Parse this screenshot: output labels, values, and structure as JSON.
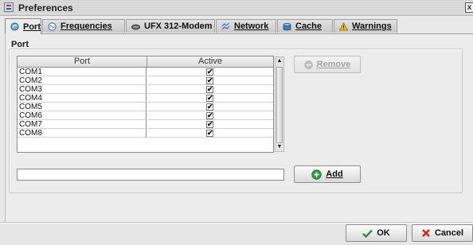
{
  "window": {
    "title": "Preferences",
    "close_glyph": "x"
  },
  "tabs": [
    {
      "label": "Port",
      "icon": "port-icon",
      "active": true
    },
    {
      "label": "Frequencies",
      "icon": "frequencies-icon",
      "active": false
    },
    {
      "label": "UFX 312-Modem",
      "icon": "modem-icon",
      "active": false
    },
    {
      "label": "Network",
      "icon": "network-icon",
      "active": false
    },
    {
      "label": "Cache",
      "icon": "cache-icon",
      "active": false
    },
    {
      "label": "Warnings",
      "icon": "warning-icon",
      "active": false
    }
  ],
  "section": {
    "title": "Port"
  },
  "table": {
    "columns": [
      "Port",
      "Active"
    ],
    "rows": [
      {
        "port": "COM1",
        "active": true
      },
      {
        "port": "COM2",
        "active": true
      },
      {
        "port": "COM3",
        "active": true
      },
      {
        "port": "COM4",
        "active": true
      },
      {
        "port": "COM5",
        "active": true
      },
      {
        "port": "COM6",
        "active": true
      },
      {
        "port": "COM7",
        "active": true
      },
      {
        "port": "COM8",
        "active": true
      }
    ],
    "check_glyph": "✔"
  },
  "buttons": {
    "remove": {
      "label": "Remove",
      "icon": "remove-icon",
      "enabled": false
    },
    "add": {
      "label": "Add",
      "icon": "add-icon",
      "enabled": true
    },
    "ok": {
      "label": "OK",
      "icon": "checkmark-icon"
    },
    "cancel": {
      "label": "Cancel",
      "icon": "cancel-icon"
    }
  },
  "new_port_input": {
    "value": "",
    "placeholder": ""
  },
  "colors": {
    "add_icon": "#2e9a3c",
    "ok_icon": "#2e8a3a",
    "cancel_icon": "#cc2a1c",
    "warning_icon": "#f2c200"
  }
}
